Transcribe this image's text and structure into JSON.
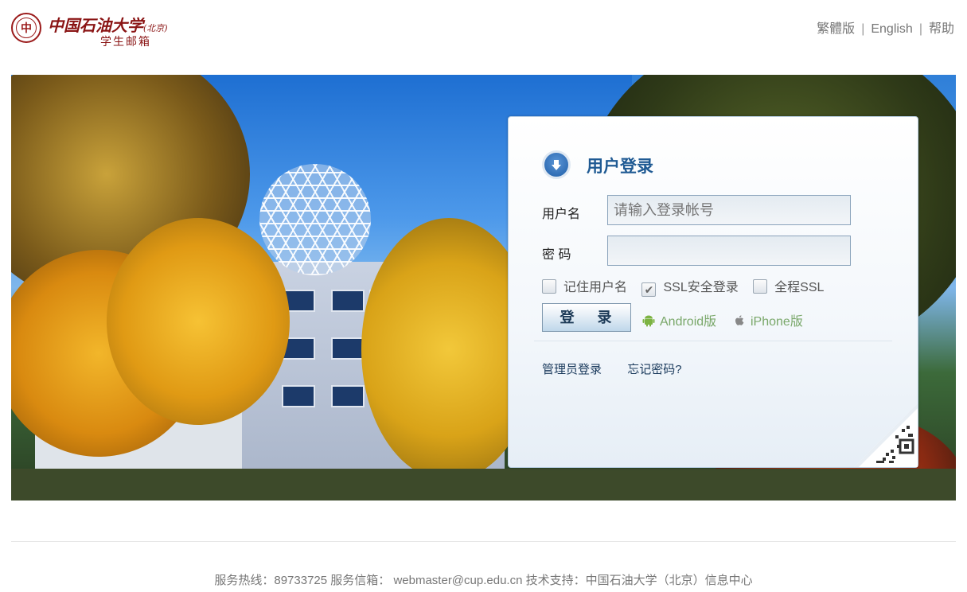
{
  "header": {
    "logo_seal_text": "中",
    "logo_name": "中国石油大学",
    "logo_name_small": "(北京)",
    "logo_sub": "学生邮箱",
    "links": [
      "繁體版",
      "English",
      "帮助"
    ]
  },
  "login": {
    "title": "用户登录",
    "username_label": "用户名",
    "username_placeholder": "请输入登录帐号",
    "password_label": "密 码",
    "checkboxes": [
      {
        "label": "记住用户名",
        "checked": false
      },
      {
        "label": "SSL安全登录",
        "checked": true
      },
      {
        "label": "全程SSL",
        "checked": false
      }
    ],
    "login_button": "登 录",
    "android_label": "Android版",
    "iphone_label": "iPhone版",
    "admin_login": "管理员登录",
    "forgot_password": "忘记密码?"
  },
  "footer": {
    "text": "服务热线：89733725 服务信箱： webmaster@cup.edu.cn 技术支持：中国石油大学（北京）信息中心"
  },
  "colors": {
    "brand_red": "#8a1414",
    "title_blue": "#1f5a93",
    "app_green": "#7aa86a"
  }
}
